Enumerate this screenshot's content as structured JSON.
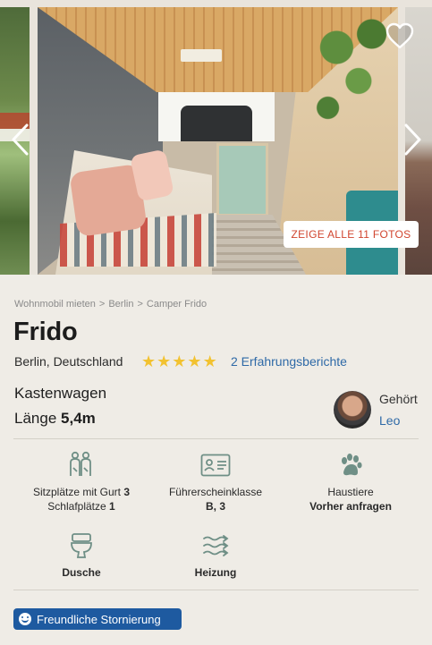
{
  "gallery": {
    "show_all_label": "ZEIGE ALLE 11 FOTOS"
  },
  "breadcrumb": [
    "Wohnmobil mieten",
    "Berlin",
    "Camper Frido"
  ],
  "listing": {
    "title": "Frido",
    "location": "Berlin, Deutschland",
    "rating_stars": 5,
    "reviews_label": "2 Erfahrungsberichte",
    "vehicle_type": "Kastenwagen",
    "length_label": "Länge",
    "length_value": "5,4m"
  },
  "owner": {
    "owned_label": "Gehört",
    "name": "Leo"
  },
  "features": {
    "seats_label": "Sitzplätze mit Gurt",
    "seats_value": "3",
    "sleeps_label": "Schlafplätze",
    "sleeps_value": "1",
    "license_label": "Führerscheinklasse",
    "license_value": "B, 3",
    "pets_label": "Haustiere",
    "pets_value": "Vorher anfragen",
    "shower_label": "Dusche",
    "heating_label": "Heizung"
  },
  "badge": {
    "label": "Freundliche Stornierung"
  },
  "colors": {
    "accent_blue": "#1e5aa0",
    "link_blue": "#2f6aa7",
    "photo_button_text": "#d1452f",
    "star": "#f2c230",
    "icon": "#6f8f86"
  }
}
